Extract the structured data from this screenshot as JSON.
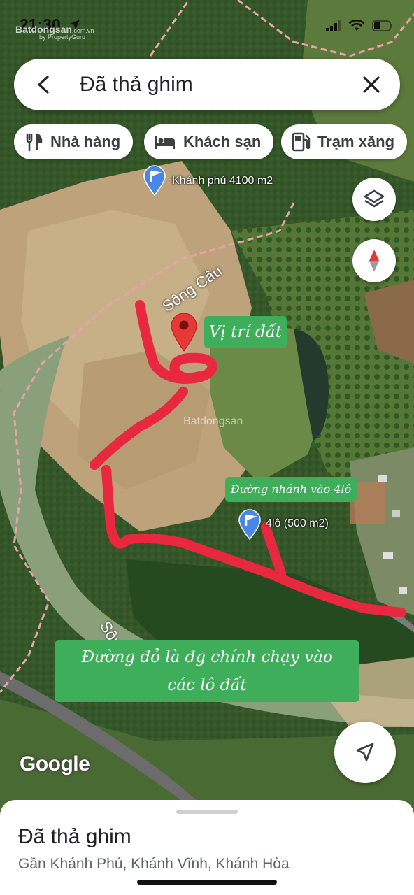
{
  "status": {
    "time": "21:30"
  },
  "watermark": {
    "brand": "Batdongsan",
    "suffix": ".com.vn",
    "sub": "by PropertyGuru"
  },
  "search": {
    "title": "Đã thả ghim"
  },
  "chips": [
    {
      "label": "Nhà hàng",
      "icon": "fork-knife-icon"
    },
    {
      "label": "Khách sạn",
      "icon": "bed-icon"
    },
    {
      "label": "Trạm xăng",
      "icon": "gas-station-icon"
    }
  ],
  "map": {
    "pins": [
      {
        "label": "Khánh phú 4100 m2",
        "icon": "flag-pin-icon"
      },
      {
        "label": "4lô (500 m2)",
        "icon": "flag-pin-icon"
      }
    ],
    "dropped_pin": {
      "icon": "red-pin-icon"
    },
    "notes": {
      "land_location": "Vị trí đất",
      "branch_road": "Đường nhánh vào 4lô",
      "main_road": "Đường đỏ là đg chính chạy vào các lô đất"
    },
    "river_label_top": "Sông Cầu",
    "river_label_bottom": "Sông Cầu",
    "attribution": "Google",
    "center_watermark": "Batdongsan"
  },
  "sheet": {
    "title": "Đã thả ghim",
    "address": "Gần Khánh Phú, Khánh Vĩnh, Khánh Hòa"
  },
  "colors": {
    "route": "#e8283f",
    "note_bg": "#3fae5a",
    "pin_blue": "#4a86e8",
    "pin_red": "#e53935"
  }
}
